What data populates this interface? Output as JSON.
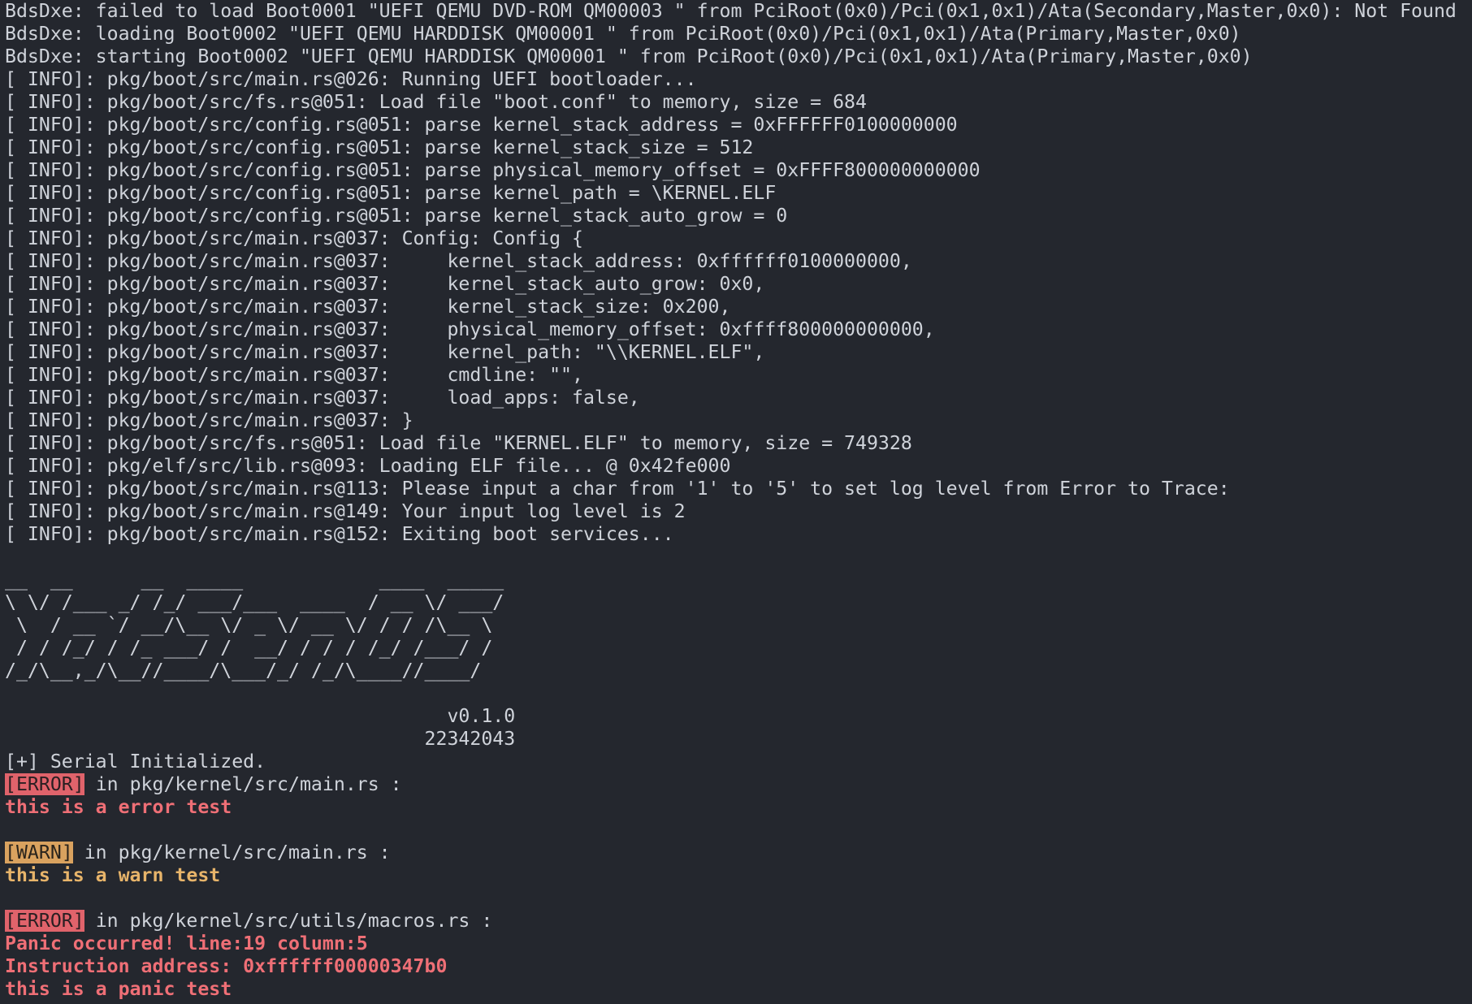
{
  "terminal": {
    "lines": [
      {
        "t": "BdsDxe: failed to load Boot0001 \"UEFI QEMU DVD-ROM QM00003 \" from PciRoot(0x0)/Pci(0x1,0x1)/Ata(Secondary,Master,0x0): Not Found"
      },
      {
        "t": "BdsDxe: loading Boot0002 \"UEFI QEMU HARDDISK QM00001 \" from PciRoot(0x0)/Pci(0x1,0x1)/Ata(Primary,Master,0x0)"
      },
      {
        "t": "BdsDxe: starting Boot0002 \"UEFI QEMU HARDDISK QM00001 \" from PciRoot(0x0)/Pci(0x1,0x1)/Ata(Primary,Master,0x0)"
      },
      {
        "t": "[ INFO]: pkg/boot/src/main.rs@026: Running UEFI bootloader..."
      },
      {
        "t": "[ INFO]: pkg/boot/src/fs.rs@051: Load file \"boot.conf\" to memory, size = 684"
      },
      {
        "t": "[ INFO]: pkg/boot/src/config.rs@051: parse kernel_stack_address = 0xFFFFFF0100000000"
      },
      {
        "t": "[ INFO]: pkg/boot/src/config.rs@051: parse kernel_stack_size = 512"
      },
      {
        "t": "[ INFO]: pkg/boot/src/config.rs@051: parse physical_memory_offset = 0xFFFF800000000000"
      },
      {
        "t": "[ INFO]: pkg/boot/src/config.rs@051: parse kernel_path = \\KERNEL.ELF"
      },
      {
        "t": "[ INFO]: pkg/boot/src/config.rs@051: parse kernel_stack_auto_grow = 0"
      },
      {
        "t": "[ INFO]: pkg/boot/src/main.rs@037: Config: Config {"
      },
      {
        "t": "[ INFO]: pkg/boot/src/main.rs@037:     kernel_stack_address: 0xffffff0100000000,"
      },
      {
        "t": "[ INFO]: pkg/boot/src/main.rs@037:     kernel_stack_auto_grow: 0x0,"
      },
      {
        "t": "[ INFO]: pkg/boot/src/main.rs@037:     kernel_stack_size: 0x200,"
      },
      {
        "t": "[ INFO]: pkg/boot/src/main.rs@037:     physical_memory_offset: 0xffff800000000000,"
      },
      {
        "t": "[ INFO]: pkg/boot/src/main.rs@037:     kernel_path: \"\\\\KERNEL.ELF\","
      },
      {
        "t": "[ INFO]: pkg/boot/src/main.rs@037:     cmdline: \"\","
      },
      {
        "t": "[ INFO]: pkg/boot/src/main.rs@037:     load_apps: false,"
      },
      {
        "t": "[ INFO]: pkg/boot/src/main.rs@037: }"
      },
      {
        "t": "[ INFO]: pkg/boot/src/fs.rs@051: Load file \"KERNEL.ELF\" to memory, size = 749328"
      },
      {
        "t": "[ INFO]: pkg/elf/src/lib.rs@093: Loading ELF file... @ 0x42fe000"
      },
      {
        "t": "[ INFO]: pkg/boot/src/main.rs@113: Please input a char from '1' to '5' to set log level from Error to Trace:"
      },
      {
        "t": "[ INFO]: pkg/boot/src/main.rs@149: Your input log level is 2"
      },
      {
        "t": "[ INFO]: pkg/boot/src/main.rs@152: Exiting boot services..."
      },
      {
        "t": ""
      },
      {
        "t": "__  __      __  _____            ____  _____"
      },
      {
        "t": "\\ \\/ /___ _/ /_/ ___/___  ____  / __ \\/ ___/"
      },
      {
        "t": " \\  / __ `/ __/\\__ \\/ _ \\/ __ \\/ / / /\\__ \\ "
      },
      {
        "t": " / / /_/ / /_ ___/ /  __/ / / / /_/ /___/ / "
      },
      {
        "t": "/_/\\__,_/\\__//____/\\___/_/ /_/\\____//____/  "
      },
      {
        "t": ""
      },
      {
        "t": "                                       v0.1.0"
      },
      {
        "t": "                                     22342043"
      },
      {
        "t": "[+] Serial Initialized."
      },
      {
        "tag": "[ERROR]",
        "style": "err",
        "t": " in pkg/kernel/src/main.rs :"
      },
      {
        "t": "this is a error test",
        "style": "err"
      },
      {
        "t": ""
      },
      {
        "tag": "[WARN]",
        "style": "warn",
        "t": " in pkg/kernel/src/main.rs :"
      },
      {
        "t": "this is a warn test",
        "style": "warn"
      },
      {
        "t": ""
      },
      {
        "tag": "[ERROR]",
        "style": "err",
        "t": " in pkg/kernel/src/utils/macros.rs :"
      },
      {
        "t": "Panic occurred! line:19 column:5",
        "style": "err"
      },
      {
        "t": "Instruction address: 0xffffff00000347b0",
        "style": "err"
      },
      {
        "t": "this is a panic test",
        "style": "err"
      }
    ]
  },
  "colors": {
    "background": "#24272e",
    "text": "#cfd3da",
    "error": "#ef6f76",
    "error_tag_bg": "#e0636b",
    "warn": "#e7b46a",
    "warn_tag_bg": "#d9a25f"
  }
}
